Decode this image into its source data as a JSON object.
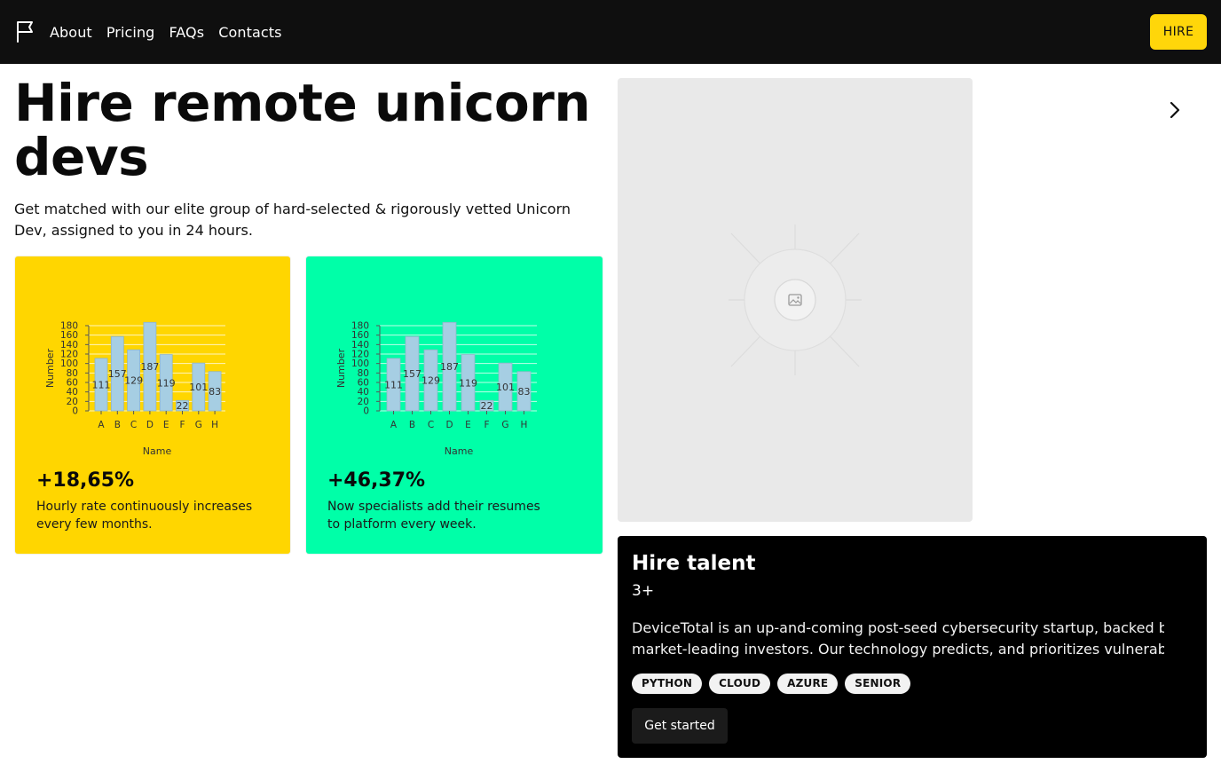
{
  "nav": {
    "links": [
      "About",
      "Pricing",
      "FAQs",
      "Contacts"
    ],
    "hire_label": "HIRE"
  },
  "hero": {
    "title": "Hire remote unicorn devs",
    "subtitle": "Get matched with our elite group of hard-selected & rigorously vetted Unicorn Dev, assigned to you in 24 hours."
  },
  "cards": [
    {
      "stat": "+18,65%",
      "description": "Hourly rate continuously increases every few months.",
      "background": "#ffd600"
    },
    {
      "stat": "+46,37%",
      "description": "Now specialists add their resumes to platform every week.",
      "background": "#00ffa8"
    }
  ],
  "chart_data": [
    {
      "type": "bar",
      "categories": [
        "A",
        "B",
        "C",
        "D",
        "E",
        "F",
        "G",
        "H"
      ],
      "values": [
        111,
        157,
        129,
        187,
        119,
        22,
        101,
        83
      ],
      "xlabel": "Name",
      "ylabel": "Number",
      "ylim": [
        0,
        180
      ],
      "yticks": [
        0,
        20,
        40,
        60,
        80,
        100,
        120,
        140,
        160,
        180
      ],
      "bar_color": "#a6cee3",
      "grid": true
    },
    {
      "type": "bar",
      "categories": [
        "A",
        "B",
        "C",
        "D",
        "E",
        "F",
        "G",
        "H"
      ],
      "values": [
        111,
        157,
        129,
        187,
        119,
        22,
        101,
        83
      ],
      "xlabel": "Name",
      "ylabel": "Number",
      "ylim": [
        0,
        180
      ],
      "yticks": [
        0,
        20,
        40,
        60,
        80,
        100,
        120,
        140,
        160,
        180
      ],
      "bar_color": "#a6cee3",
      "grid": true
    }
  ],
  "talent": {
    "title": "Hire talent",
    "experience": "3+",
    "description_line1": "DeviceTotal is an up-and-coming post-seed cybersecurity startup, backed by",
    "description_line2": "market-leading investors. Our technology predicts, and prioritizes vulnerabil",
    "tags": [
      "PYTHON",
      "CLOUD",
      "AZURE",
      "SENIOR"
    ],
    "cta_label": "Get started"
  },
  "icons": {
    "logo": "flag-icon",
    "carousel_next": "chevron-right-icon",
    "image_placeholder": "image-icon"
  }
}
